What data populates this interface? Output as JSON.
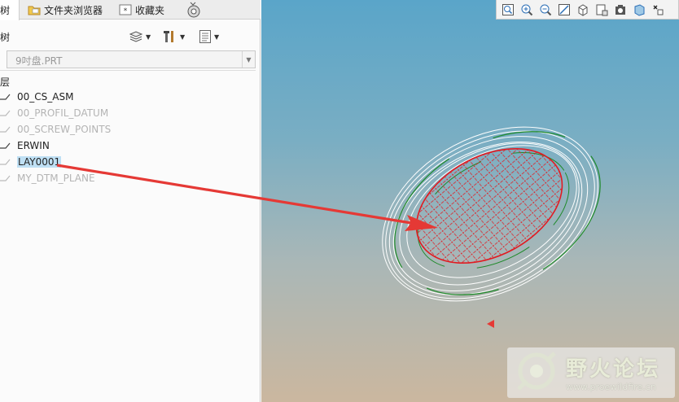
{
  "tabs": [
    {
      "label": "层树",
      "icon": "layer-tree-icon"
    },
    {
      "label": "文件夹浏览器",
      "icon": "folder-icon"
    },
    {
      "label": "收藏夹",
      "icon": "favorites-icon"
    }
  ],
  "panel": {
    "title": "层树",
    "model_select_value": "9吋盘.PRT",
    "tree_root": "层"
  },
  "layers": [
    {
      "name": "00_CS_ASM",
      "dimmed": false,
      "selected": false
    },
    {
      "name": "00_PROFIL_DATUM",
      "dimmed": true,
      "selected": false
    },
    {
      "name": "00_SCREW_POINTS",
      "dimmed": true,
      "selected": false
    },
    {
      "name": "ERWIN",
      "dimmed": false,
      "selected": false
    },
    {
      "name": "LAY0001",
      "dimmed": false,
      "selected": true
    },
    {
      "name": "MY_DTM_PLANE",
      "dimmed": true,
      "selected": false
    }
  ],
  "view_toolbar_icons": [
    "zoom-window-icon",
    "zoom-in-icon",
    "zoom-out-icon",
    "refit-icon",
    "orientation-icon",
    "saved-views-icon",
    "display-style-icon",
    "perspective-icon",
    "appearance-icon"
  ],
  "watermark": {
    "title": "野火论坛",
    "url": "www.proewildfire.cn"
  },
  "colors": {
    "selection": "#bfe0f4",
    "highlight_red": "#e11b22",
    "arrow_red": "#e53935",
    "edge_white": "#ffffff",
    "edge_green": "#1f8a2a"
  }
}
